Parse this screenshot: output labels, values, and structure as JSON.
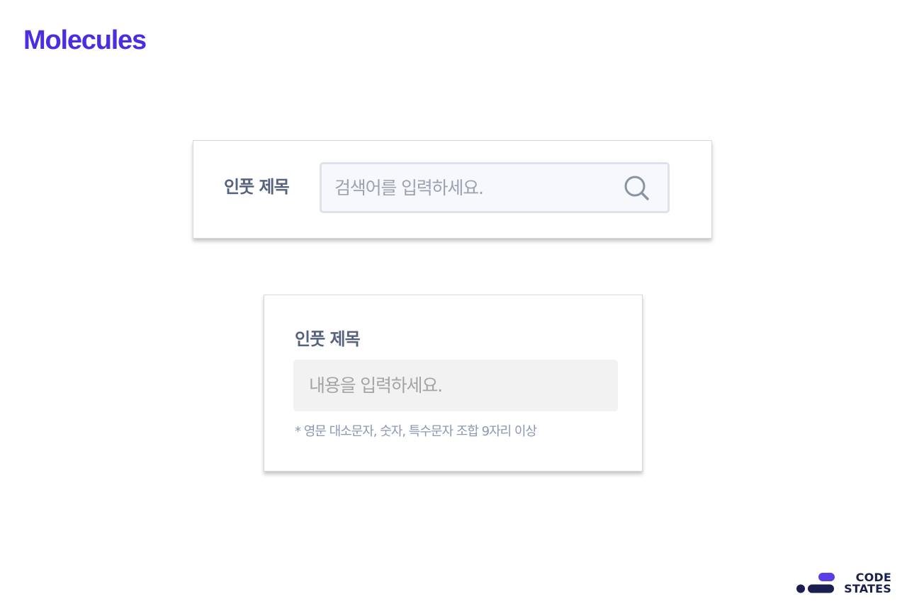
{
  "page": {
    "title": "Molecules"
  },
  "search_field": {
    "label": "인풋 제목",
    "placeholder": "검색어를 입력하세요.",
    "value": "",
    "icon": "search-icon"
  },
  "content_field": {
    "label": "인풋 제목",
    "placeholder": "내용을 입력하세요.",
    "value": "",
    "helper": "* 영문 대소문자, 숫자, 특수문자 조합 9자리 이상"
  },
  "brand": {
    "line1": "CODE",
    "line2": "STATES"
  },
  "colors": {
    "title": "#4a2ee0",
    "label": "#56637f",
    "helper": "#8d97b3",
    "logo_accent": "#5b3ee6",
    "logo_dark": "#1a1f4f"
  }
}
